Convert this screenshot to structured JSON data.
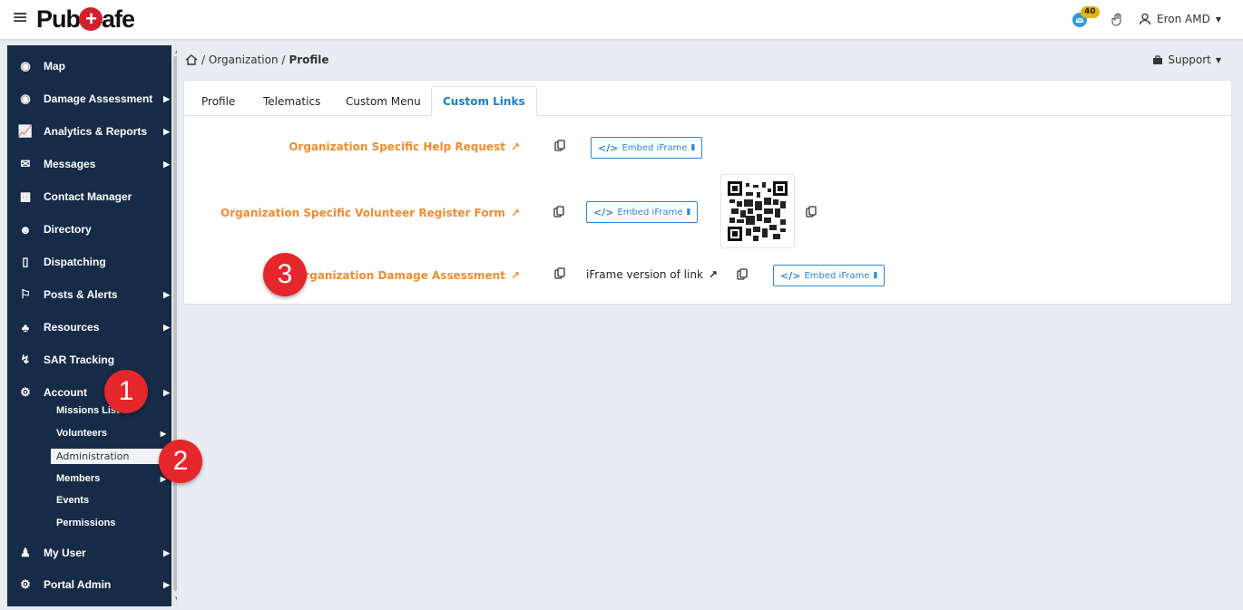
{
  "header": {
    "logo_pre": "Pub",
    "logo_cross": "+",
    "logo_post": "afe",
    "notification_count": "40",
    "user_name": "Eron AMD"
  },
  "breadcrumb": {
    "home_sep": "/ Organization /",
    "current": "Profile"
  },
  "support_label": "Support",
  "sidebar": {
    "items": [
      {
        "label": "Map"
      },
      {
        "label": "Damage Assessment"
      },
      {
        "label": "Analytics & Reports"
      },
      {
        "label": "Messages"
      },
      {
        "label": "Contact Manager"
      },
      {
        "label": "Directory"
      },
      {
        "label": "Dispatching"
      },
      {
        "label": "Posts & Alerts"
      },
      {
        "label": "Resources"
      },
      {
        "label": "SAR Tracking"
      },
      {
        "label": "Account"
      },
      {
        "label": "My User"
      },
      {
        "label": "Portal Admin"
      }
    ],
    "account_sub": [
      {
        "label": "Missions List"
      },
      {
        "label": "Volunteers"
      },
      {
        "label": "Administration"
      },
      {
        "label": "Members"
      },
      {
        "label": "Events"
      },
      {
        "label": "Permissions"
      }
    ]
  },
  "tabs": [
    {
      "label": "Profile"
    },
    {
      "label": "Telematics"
    },
    {
      "label": "Custom Menu"
    },
    {
      "label": "Custom Links"
    }
  ],
  "links": [
    {
      "label": "Organization Specific Help Request"
    },
    {
      "label": "Organization Specific Volunteer Register Form"
    },
    {
      "label": "Organization Damage Assessment"
    }
  ],
  "embed_label": "Embed iFrame",
  "iframe_version_label": "iFrame version of link",
  "markers": [
    "1",
    "2",
    "3"
  ],
  "colors": {
    "sidebar_bg": "#162b47",
    "link_orange": "#f08c2e",
    "accent_blue": "#2a86d8",
    "marker_red": "#e5262a"
  }
}
